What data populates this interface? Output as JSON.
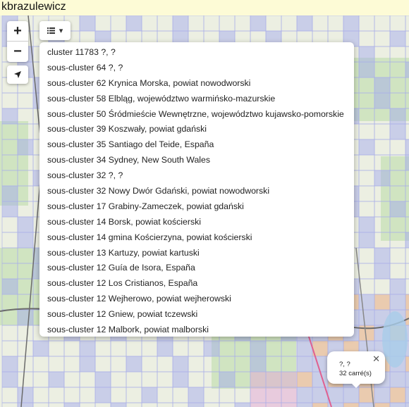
{
  "header": {
    "username": "kbrazulewicz"
  },
  "controls": {
    "zoom_in": "+",
    "zoom_out": "−",
    "locate_icon": "location-arrow-icon",
    "layers_icon": "list-icon",
    "layers_caret": "▾"
  },
  "dropdown": {
    "items": [
      "cluster 11783 ?, ?",
      "sous-cluster 64 ?, ?",
      "sous-cluster 62 Krynica Morska, powiat nowodworski",
      "sous-cluster 58 Elbląg, województwo warmińsko-mazurskie",
      "sous-cluster 50 Śródmieście Wewnętrzne, województwo kujawsko-pomorskie",
      "sous-cluster 39 Koszwały, powiat gdański",
      "sous-cluster 35 Santiago del Teide, España",
      "sous-cluster 34 Sydney, New South Wales",
      "sous-cluster 32 ?, ?",
      "sous-cluster 32 Nowy Dwór Gdański, powiat nowodworski",
      "sous-cluster 17 Grabiny-Zameczek, powiat gdański",
      "sous-cluster 14 Borsk, powiat kościerski",
      "sous-cluster 14 gmina Kościerzyna, powiat kościerski",
      "sous-cluster 13 Kartuzy, powiat kartuski",
      "sous-cluster 12 Guía de Isora, España",
      "sous-cluster 12 Los Cristianos, España",
      "sous-cluster 12 Wejherowo, powiat wejherowski",
      "sous-cluster 12 Gniew, powiat tczewski",
      "sous-cluster 12 Malbork, powiat malborski"
    ]
  },
  "popup": {
    "line1": "?, ?",
    "line2": "32 carré(s)",
    "close": "✕"
  },
  "colors": {
    "background": "#fdfbd6",
    "map_base": "#ecefe2",
    "square_blue": "#9fa6f0",
    "square_orange": "#e8a070",
    "square_pink": "#e59fd6",
    "forest": "#c4e0b4",
    "water": "#a9cde8"
  }
}
